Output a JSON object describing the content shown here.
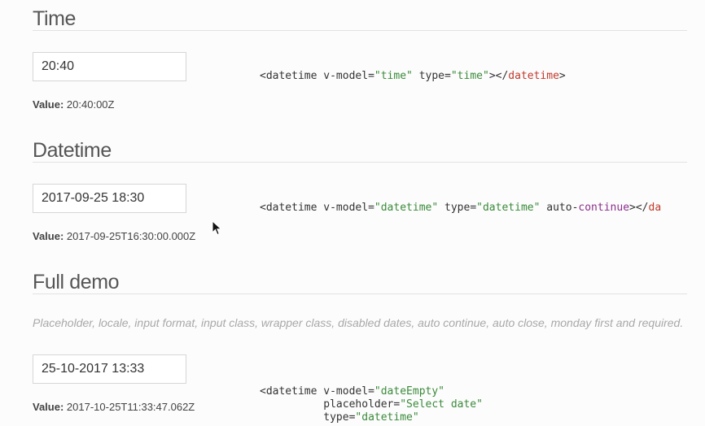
{
  "sections": [
    {
      "title": "Time",
      "input_value": "20:40",
      "value_label": "Value:",
      "value_text": "20:40:00Z",
      "code": {
        "tag_open": "<datetime",
        "attr1_name": " v-model=",
        "attr1_value": "\"time\"",
        "attr2_name": " type=",
        "attr2_value": "\"time\"",
        "close": "></",
        "tag_close": "datetime",
        "end": ">"
      }
    },
    {
      "title": "Datetime",
      "input_value": "2017-09-25 18:30",
      "value_label": "Value:",
      "value_text": "2017-09-25T16:30:00.000Z",
      "code": {
        "tag_open": "<datetime",
        "attr1_name": " v-model=",
        "attr1_value": "\"datetime\"",
        "attr2_name": " type=",
        "attr2_value": "\"datetime\"",
        "attr3_pre": " auto-",
        "attr3_kw": "continue",
        "close": "></",
        "tag_close": "da"
      }
    },
    {
      "title": "Full demo",
      "description": "Placeholder, locale, input format, input class, wrapper class, disabled dates, auto continue, auto close, monday first and required.",
      "input_value": "25-10-2017 13:33",
      "value_label": "Value:",
      "value_text": "2017-10-25T11:33:47.062Z",
      "code": {
        "tag_open": "<datetime",
        "attr1_name": " v-model=",
        "attr1_value": "\"dateEmpty\"",
        "indent": "          ",
        "attr2_name": "placeholder=",
        "attr2_value": "\"Select date\"",
        "attr3_name": "type=",
        "attr3_value": "\"datetime\""
      }
    }
  ],
  "colors": {
    "string": "#3a8a3a",
    "tag": "#c0392b",
    "keyword": "#8b2e8b"
  },
  "icons": [
    "mouse-pointer-icon"
  ]
}
